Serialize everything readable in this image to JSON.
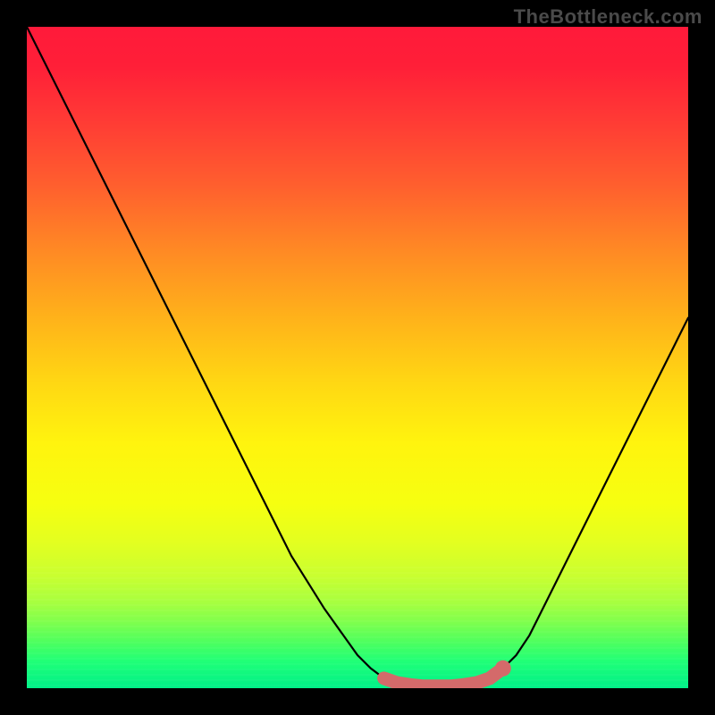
{
  "watermark": "TheBottleneck.com",
  "chart_data": {
    "type": "line",
    "title": "",
    "xlabel": "",
    "ylabel": "",
    "xlim": [
      0,
      100
    ],
    "ylim": [
      0,
      100
    ],
    "x": [
      0,
      5,
      10,
      15,
      20,
      25,
      30,
      35,
      40,
      45,
      50,
      52,
      54,
      56,
      58,
      60,
      62,
      64,
      66,
      68,
      70,
      72,
      74,
      76,
      78,
      82,
      86,
      90,
      94,
      98,
      100
    ],
    "values": [
      100,
      90,
      80,
      70,
      60,
      50,
      40,
      30,
      20,
      12,
      5,
      3,
      1.5,
      0.8,
      0.5,
      0.3,
      0.3,
      0.3,
      0.5,
      0.8,
      1.5,
      3,
      5,
      8,
      12,
      20,
      28,
      36,
      44,
      52,
      56
    ],
    "colors": {
      "gradient_top": "#ff1a3a",
      "gradient_mid1": "#ffb21a",
      "gradient_mid2": "#fff40e",
      "gradient_bottom": "#00f088",
      "curve": "#000000",
      "valley_highlight": "#d46a6a",
      "valley_dot": "#d46a6a",
      "frame": "#000000"
    },
    "valley": {
      "x_start": 54,
      "x_end": 72,
      "dot_x": 72,
      "dot_y": 3
    },
    "annotations": []
  }
}
